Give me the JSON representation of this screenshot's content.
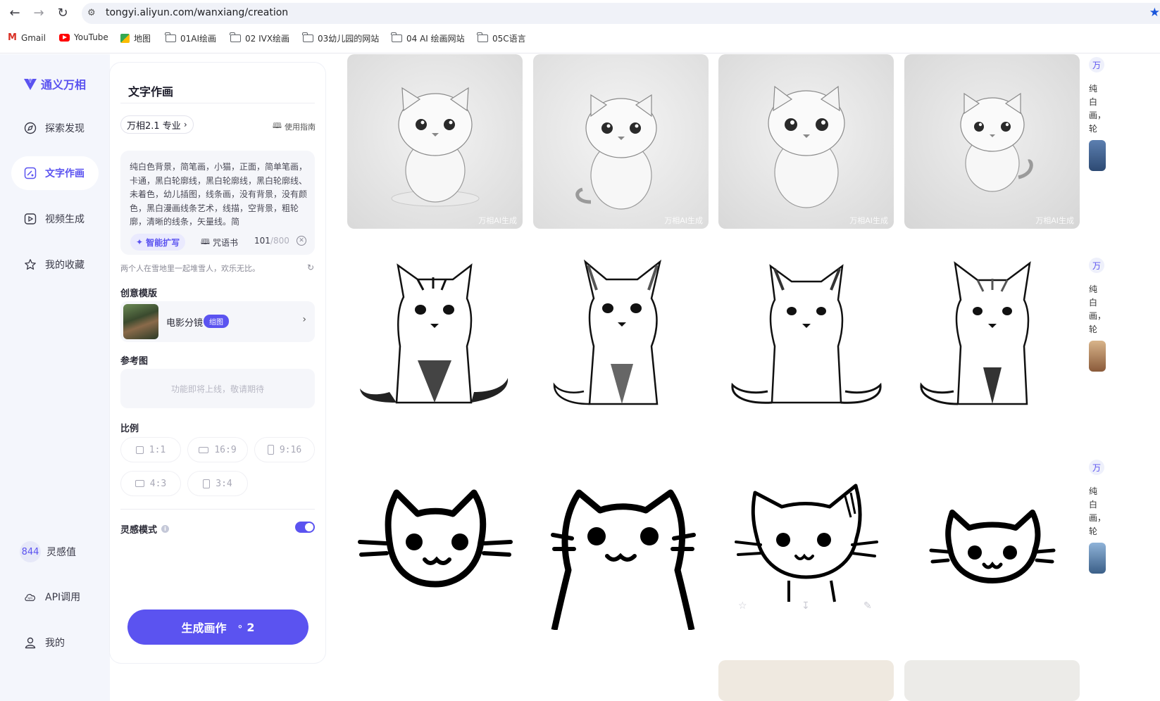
{
  "browser": {
    "url": "tongyi.aliyun.com/wanxiang/creation",
    "bookmarks": [
      "Gmail",
      "YouTube",
      "地图",
      "01AI绘画",
      "02 IVX绘画",
      "03幼儿园的网站",
      "04 AI 绘画网站",
      "05C语言"
    ]
  },
  "sidebar": {
    "brand": "通义万相",
    "items": [
      {
        "label": "探索发现",
        "icon": "compass-icon"
      },
      {
        "label": "文字作画",
        "icon": "image-edit-icon"
      },
      {
        "label": "视频生成",
        "icon": "video-icon"
      },
      {
        "label": "我的收藏",
        "icon": "star-icon"
      }
    ],
    "inspiration_value": "844",
    "inspiration_label": "灵感值",
    "api_label": "API调用",
    "me_label": "我的"
  },
  "panel": {
    "title": "文字作画",
    "model": "万相2.1 专业",
    "guide": "使用指南",
    "prompt": "纯白色背景，简笔画，小猫，正面，简单笔画，卡通，黑白轮廓线，黑白轮廓线，黑白轮廓线、未着色，幼儿插图，线条画，没有背景，没有颜色，黑白漫画线条艺术，线描，空背景，粗轮廓，清晰的线条，矢量线。简",
    "magic_expand": "智能扩写",
    "spell_book": "咒语书",
    "count": "101",
    "count_max": "/800",
    "hint": "两个人在雪地里一起堆雪人，欢乐无比。",
    "template_label": "创意模版",
    "template_name": "电影分镜",
    "template_badge": "组图",
    "reference_label": "参考图",
    "reference_placeholder": "功能即将上线，敬请期待",
    "ratio_label": "比例",
    "ratios": [
      "1:1",
      "16:9",
      "9:16",
      "4:3",
      "3:4"
    ],
    "inspiration_mode": "灵感模式",
    "inspiration_mode_on": true,
    "generate_label": "生成画作",
    "generate_cost": "2"
  },
  "gallery": {
    "watermark": "万相AI生成",
    "right_tag": "万",
    "right_text": "纯白画，轮"
  },
  "colors": {
    "accent": "#5b53f0",
    "sidebar_bg": "#f4f6fc"
  }
}
